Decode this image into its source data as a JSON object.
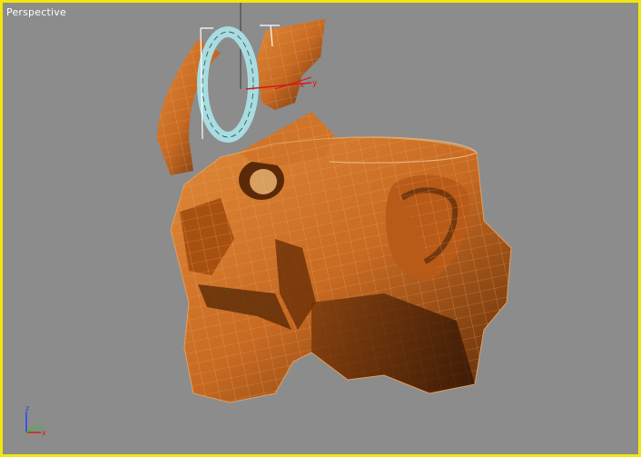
{
  "viewport": {
    "label": "Perspective",
    "border_color": "#f2e60f",
    "background_color": "#8c8c8c"
  },
  "gizmo": {
    "axis_x_label": "x",
    "axis_y_label": "y",
    "x_color": "#d81818",
    "y_color": "#d81818"
  },
  "axis_tripod": {
    "z_label": "z",
    "x_label": "x",
    "y_label": "y",
    "z_color": "#2244ff",
    "x_color": "#e01818",
    "y_color": "#22cc22"
  },
  "model": {
    "skin_color": "#c86a22",
    "wire_color": "#e0a060",
    "ring_color": "#a8dce0"
  }
}
